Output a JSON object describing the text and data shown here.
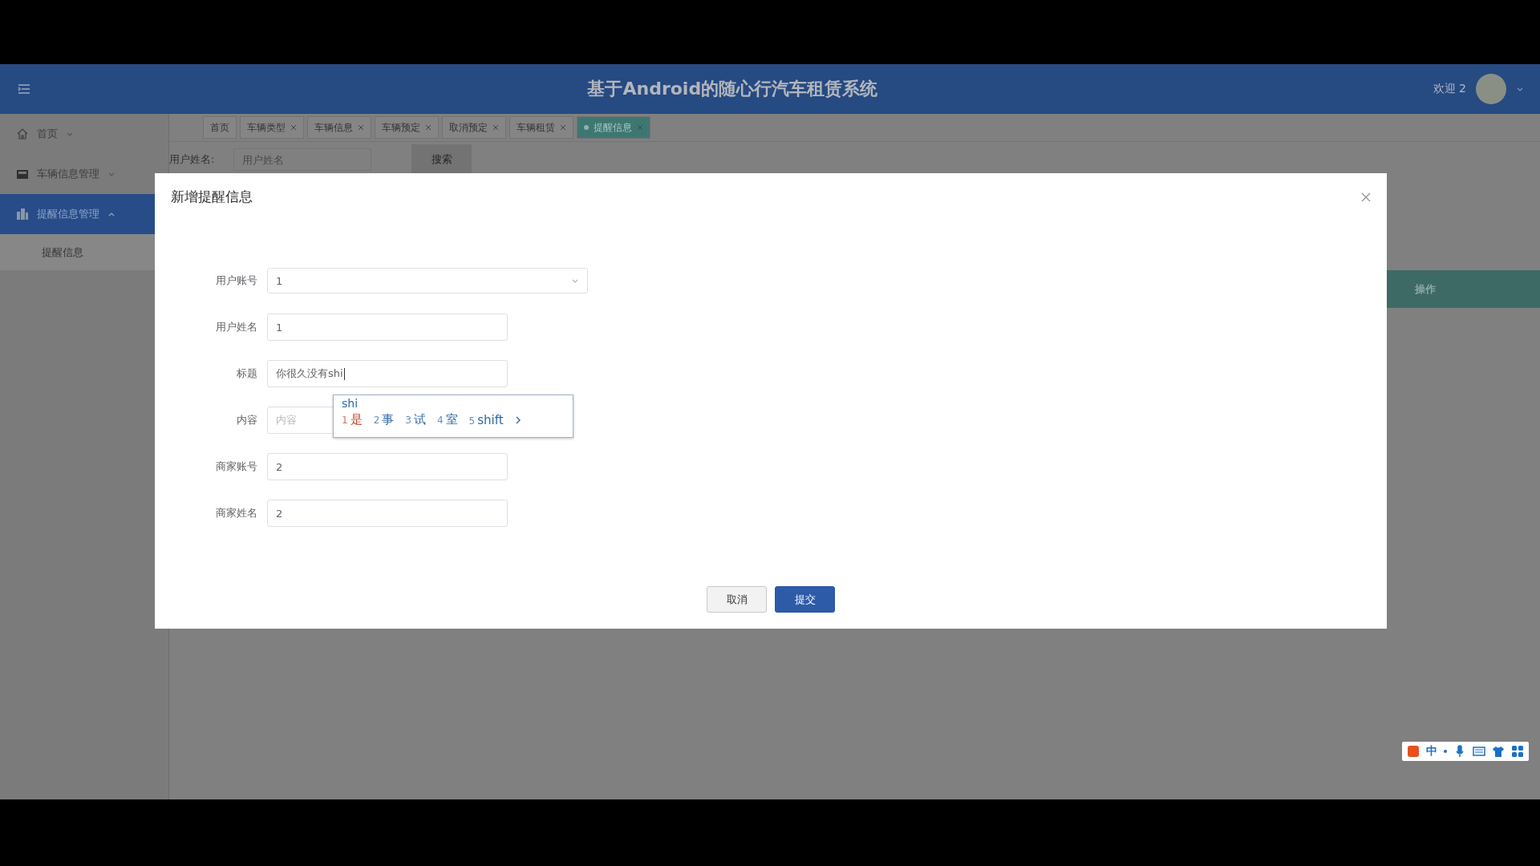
{
  "header": {
    "title": "基于Android的随心行汽车租赁系统",
    "welcome": "欢迎 2"
  },
  "sidebar": {
    "items": [
      {
        "label": "首页",
        "expanded": false,
        "selected": false
      },
      {
        "label": "车辆信息管理",
        "expanded": false,
        "selected": false
      },
      {
        "label": "提醒信息管理",
        "expanded": true,
        "selected": true,
        "children": [
          {
            "label": "提醒信息",
            "selected": false
          }
        ]
      }
    ]
  },
  "tabs": [
    {
      "label": "首页",
      "closable": false,
      "selected": false
    },
    {
      "label": "车辆类型",
      "closable": true,
      "selected": false
    },
    {
      "label": "车辆信息",
      "closable": true,
      "selected": false
    },
    {
      "label": "车辆预定",
      "closable": true,
      "selected": false
    },
    {
      "label": "取消预定",
      "closable": true,
      "selected": false
    },
    {
      "label": "车辆租赁",
      "closable": true,
      "selected": false
    },
    {
      "label": "提醒信息",
      "closable": true,
      "selected": true
    }
  ],
  "search": {
    "label": "用户姓名:",
    "placeholder": "用户姓名",
    "button": "搜索"
  },
  "table": {
    "columns": [
      "操作"
    ]
  },
  "dialog": {
    "title": "新增提醒信息",
    "fields": [
      {
        "label": "用户账号",
        "kind": "select",
        "value": "1"
      },
      {
        "label": "用户姓名",
        "kind": "input",
        "value": "1"
      },
      {
        "label": "标题",
        "kind": "input",
        "value": "你很久没有shi",
        "focused": true
      },
      {
        "label": "内容",
        "kind": "input",
        "placeholder": "内容"
      },
      {
        "label": "商家账号",
        "kind": "input",
        "value": "2"
      },
      {
        "label": "商家姓名",
        "kind": "input",
        "value": "2"
      }
    ],
    "buttons": [
      {
        "label": "取消",
        "kind": "default"
      },
      {
        "label": "提交",
        "kind": "primary"
      }
    ]
  },
  "ime": {
    "composition": "shi",
    "candidates": [
      {
        "index": "1",
        "text": "是",
        "selected": true
      },
      {
        "index": "2",
        "text": "事",
        "selected": false
      },
      {
        "index": "3",
        "text": "试",
        "selected": false
      },
      {
        "index": "4",
        "text": "室",
        "selected": false
      },
      {
        "index": "5",
        "text": "shift",
        "selected": false
      }
    ],
    "toolbar_mode": "中"
  }
}
